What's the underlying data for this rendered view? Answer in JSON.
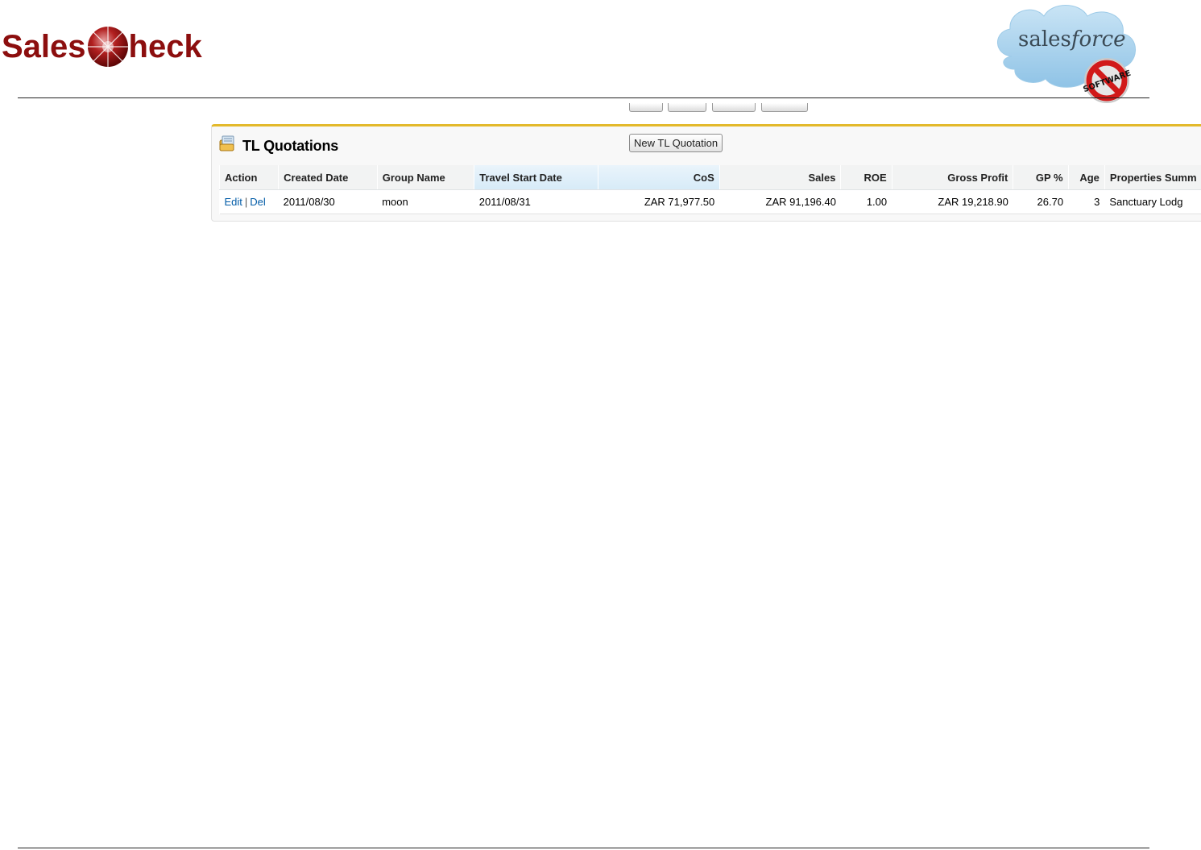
{
  "header": {
    "salescheck_left": "Sales",
    "salescheck_right": "heck",
    "salesforce_word_plain": "sales",
    "salesforce_word_italic": "force",
    "software_badge": "SOFTWARE"
  },
  "panel": {
    "title": "TL Quotations",
    "new_button": "New TL Quotation"
  },
  "table": {
    "columns": [
      "Action",
      "Created Date",
      "Group Name",
      "Travel Start Date",
      "CoS",
      "Sales",
      "ROE",
      "Gross Profit",
      "GP %",
      "Age",
      "Properties Summ"
    ],
    "rows": [
      {
        "edit": "Edit",
        "sep": "|",
        "del": "Del",
        "created_date": "2011/08/30",
        "group_name": "moon",
        "travel_start_date": "2011/08/31",
        "cos": "ZAR 71,977.50",
        "sales": "ZAR 91,196.40",
        "roe": "1.00",
        "gross_profit": "ZAR 19,218.90",
        "gp_pct": "26.70",
        "age": "3",
        "properties_summary": "Sanctuary Lodg"
      }
    ]
  },
  "colors": {
    "brand_red": "#8c0e0e",
    "panel_accent": "#e3b92b",
    "link_blue": "#015ba7"
  }
}
